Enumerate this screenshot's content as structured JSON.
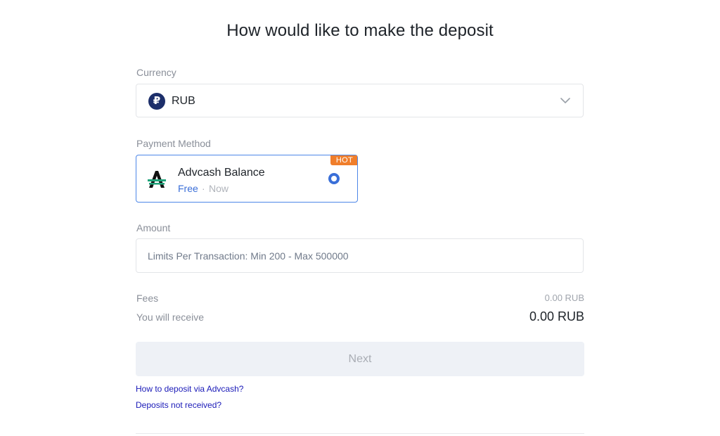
{
  "page": {
    "title": "How would like to make the deposit"
  },
  "currency": {
    "label": "Currency",
    "selected": "RUB",
    "icon": "ruble-icon",
    "icon_glyph": "₽",
    "icon_color": "#1d2f6a"
  },
  "payment_method": {
    "label": "Payment Method",
    "options": [
      {
        "name": "Advcash Balance",
        "fee": "Free",
        "separator": "·",
        "time": "Now",
        "badge": "HOT",
        "icon": "advcash-logo",
        "selected": true
      }
    ],
    "accent_color": "#3a6fd8",
    "badge_color": "#f07e2b"
  },
  "amount": {
    "label": "Amount",
    "placeholder": "Limits Per Transaction: Min 200 - Max 500000",
    "value": ""
  },
  "summary": {
    "fees_label": "Fees",
    "fees_value": "0.00 RUB",
    "receive_label": "You will receive",
    "receive_value": "0.00 RUB"
  },
  "actions": {
    "next_label": "Next",
    "next_enabled": false
  },
  "links": {
    "how_to_deposit": "How to deposit via Advcash?",
    "not_received": "Deposits not received?"
  }
}
